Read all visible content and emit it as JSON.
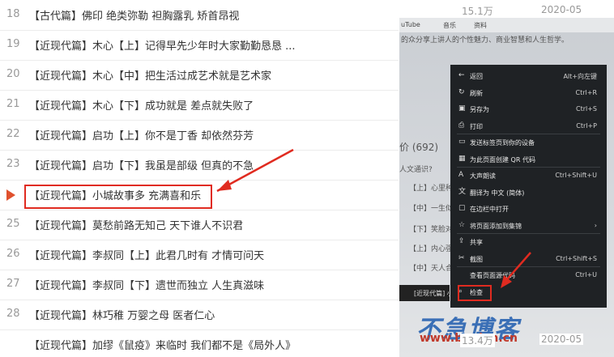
{
  "playlist": {
    "rows": [
      {
        "num": "18",
        "title": "【古代篇】佛印 绝类弥勒 袒胸露乳 矫首昂视",
        "plays": "15.1万",
        "date": "2020-05"
      },
      {
        "num": "19",
        "title": "【近现代篇】木心【上】记得早先少年时大家勤勤恳恳 ...",
        "plays": "",
        "date": ""
      },
      {
        "num": "20",
        "title": "【近现代篇】木心【中】把生活过成艺术就是艺术家",
        "plays": "",
        "date": ""
      },
      {
        "num": "21",
        "title": "【近现代篇】木心【下】成功就是 差点就失败了",
        "plays": "",
        "date": ""
      },
      {
        "num": "22",
        "title": "【近现代篇】启功【上】你不是丁香 却依然芬芳",
        "plays": "",
        "date": ""
      },
      {
        "num": "23",
        "title": "【近现代篇】启功【下】我虽是部级 但真的不急",
        "plays": "",
        "date": ""
      },
      {
        "num": "",
        "title": "【近现代篇】小城故事多 充满喜和乐",
        "plays": "",
        "date": "",
        "playing": true
      },
      {
        "num": "25",
        "title": "【近现代篇】莫愁前路无知己 天下谁人不识君",
        "plays": "",
        "date": ""
      },
      {
        "num": "26",
        "title": "【近现代篇】李叔同【上】此君几时有 才情可问天",
        "plays": "",
        "date": ""
      },
      {
        "num": "27",
        "title": "【近现代篇】李叔同【下】遗世而独立 人生真滋味",
        "plays": "",
        "date": ""
      },
      {
        "num": "28",
        "title": "【近现代篇】林巧稚 万婴之母 医者仁心",
        "plays": "",
        "date": ""
      },
      {
        "num": "",
        "title": "【近现代篇】加缪《鼠疫》来临时 我们都不是《局外人》",
        "plays": "13.4万",
        "date": "2020-05"
      }
    ]
  },
  "photo": {
    "tabs": [
      "uTube",
      "音乐",
      "资料"
    ],
    "bg_text": [
      "的众分享上讲人的个性魅力、商业智慧和人生哲学。",
      "价 (692)",
      "人文通识?",
      "【上】心里种",
      "【中】一生似",
      "【下】笑脸对",
      "【上】内心强大",
      "【中】天人合一"
    ],
    "context_menu": [
      {
        "icon": "←",
        "label": "返回",
        "shortcut": "Alt+向左键"
      },
      {
        "icon": "↻",
        "label": "刷新",
        "shortcut": "Ctrl+R"
      },
      {
        "icon": "▣",
        "label": "另存为",
        "shortcut": "Ctrl+S"
      },
      {
        "icon": "⎙",
        "label": "打印",
        "shortcut": "Ctrl+P"
      },
      {
        "icon": "▭",
        "label": "发送标签页到你的设备",
        "shortcut": ""
      },
      {
        "icon": "▦",
        "label": "为此页面创建 QR 代码",
        "shortcut": ""
      },
      {
        "icon": "A",
        "label": "大声朗读",
        "shortcut": "Ctrl+Shift+U"
      },
      {
        "icon": "文",
        "label": "翻译为 中文 (简体)",
        "shortcut": ""
      },
      {
        "icon": "▢",
        "label": "在边栏中打开",
        "shortcut": ""
      },
      {
        "icon": "☆",
        "label": "将页面添加到集锦",
        "shortcut": "›"
      },
      {
        "icon": "⇪",
        "label": "共享",
        "shortcut": ""
      },
      {
        "icon": "✂",
        "label": "截图",
        "shortcut": "Ctrl+Shift+S"
      },
      {
        "icon": "",
        "label": "查看页面源代码",
        "shortcut": "Ctrl+U"
      },
      {
        "icon": "⌕",
        "label": "检查",
        "shortcut": ""
      }
    ],
    "strip_label": "[近现代篇] 小",
    "watermark_cn": "不急博客",
    "watermark_url": "www.bunian.cn"
  },
  "colors": {
    "highlight": "#e02b20",
    "play": "#e0512e"
  }
}
